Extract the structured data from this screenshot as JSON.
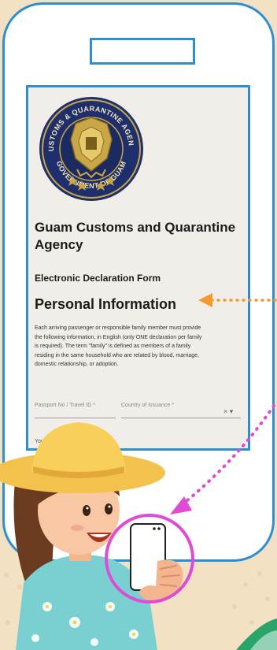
{
  "colors": {
    "background": "#f3e1c4",
    "phone_outline": "#2e8fd0",
    "arrow_orange": "#f29a2e",
    "arrow_pink": "#e04bd6"
  },
  "form": {
    "agency_title_line1": "Guam Customs and Quarantine",
    "agency_title_line2": "Agency",
    "form_subtitle": "Electronic Declaration Form",
    "section_title": "Personal Information",
    "paragraph_lines": [
      "Each arriving passenger or responsible family member must provide",
      "the following information, in English (only ONE declaration per family",
      "is required). The term \"family\" is defined as members of a family",
      "residing in the same household who are related by blood, marriage,",
      "domestic relationship, or adoption."
    ],
    "field_passport_label": "Passport No / Travel ID *",
    "field_country_label": "Country of Issuance *",
    "field_country_icons": "× ▾",
    "field_name_label": "Your Full name"
  },
  "seal": {
    "top_text": "CUSTOMS & QUARANTINE AGENCY",
    "bottom_text": "GOVERNMENT OF GUAM"
  }
}
